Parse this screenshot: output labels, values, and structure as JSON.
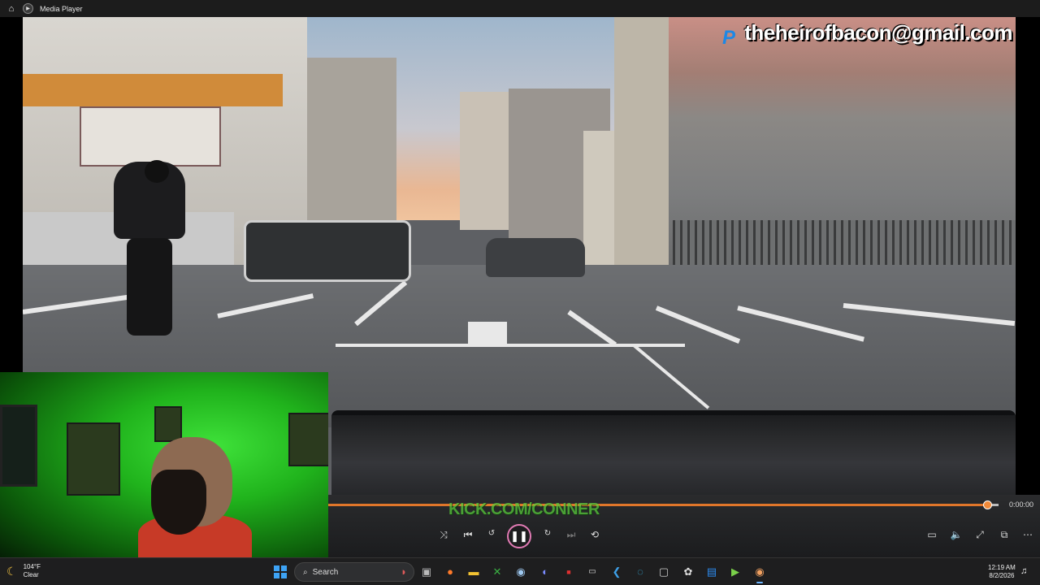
{
  "window": {
    "title": "Media Player"
  },
  "overlay": {
    "email": "theheirofbacon@gmail.com"
  },
  "video": {
    "watermark": "KICK.COM/CONNER"
  },
  "player": {
    "current_time": "0:00:00",
    "progress": 0.985
  },
  "taskbar": {
    "weather": {
      "temp": "104°F",
      "condition": "Clear"
    },
    "search_placeholder": "Search",
    "clock": {
      "time": "12:19 AM",
      "date": "8/2/2026"
    }
  },
  "colors": {
    "accent": "#e0762a",
    "play_ring": "#e07ab3",
    "kick_green": "#57c93a"
  }
}
